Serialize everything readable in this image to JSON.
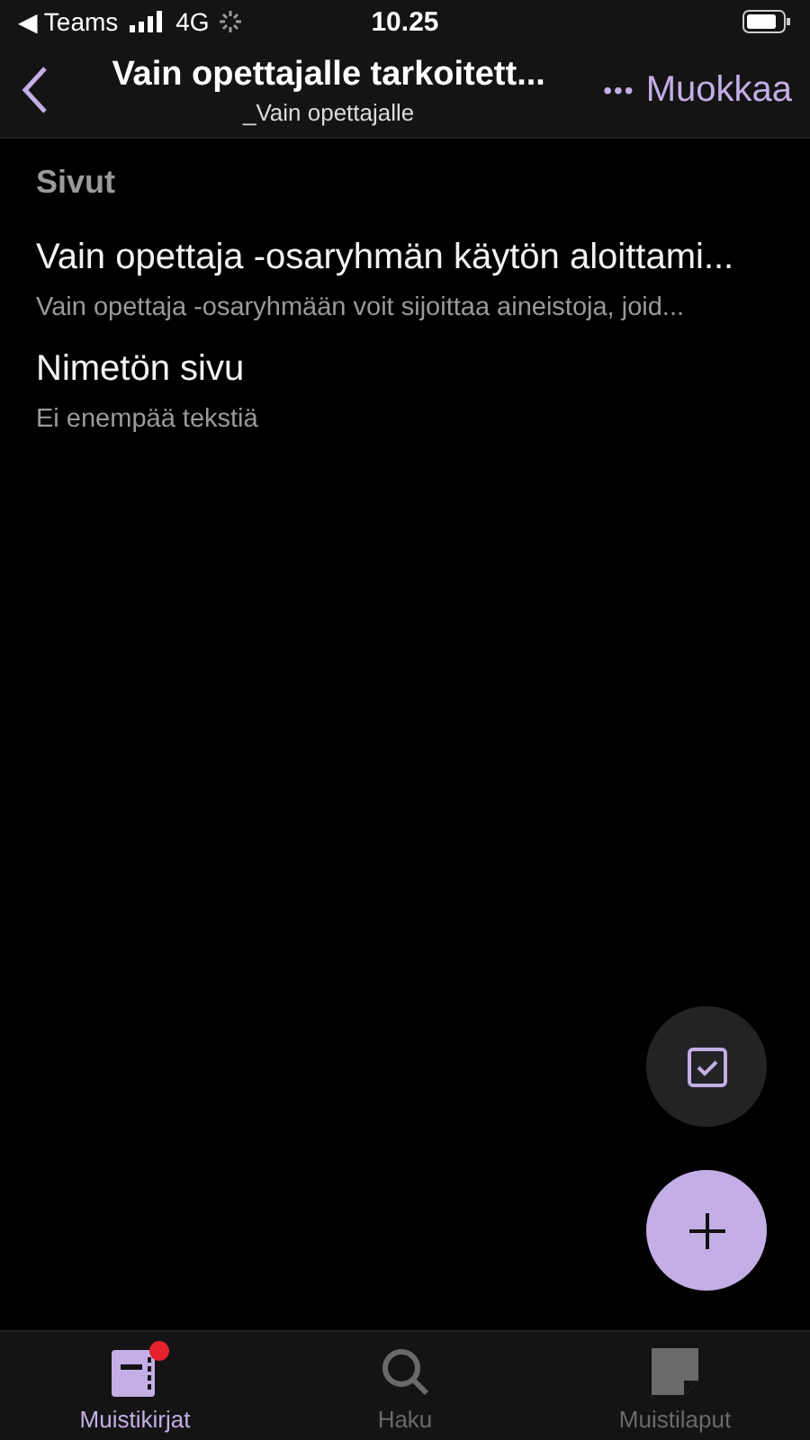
{
  "status_bar": {
    "back_app": "◀ Teams",
    "network": "4G",
    "time": "10.25"
  },
  "header": {
    "title": "Vain opettajalle tarkoitett...",
    "subtitle": "_Vain opettajalle",
    "more": "•••",
    "edit": "Muokkaa"
  },
  "section": "Sivut",
  "pages": [
    {
      "title": "Vain opettaja -osaryhmän käytön aloittami...",
      "preview": "Vain opettaja -osaryhmään voit sijoittaa aineistoja, joid..."
    },
    {
      "title": "Nimetön sivu",
      "preview": "Ei enempää tekstiä"
    }
  ],
  "tabs": [
    {
      "kind": "notebook",
      "label": "Muistikirjat",
      "selected": true,
      "badge": true
    },
    {
      "kind": "search",
      "label": "Haku",
      "selected": false,
      "badge": false
    },
    {
      "kind": "sticky",
      "label": "Muistilaput",
      "selected": false,
      "badge": false
    }
  ]
}
